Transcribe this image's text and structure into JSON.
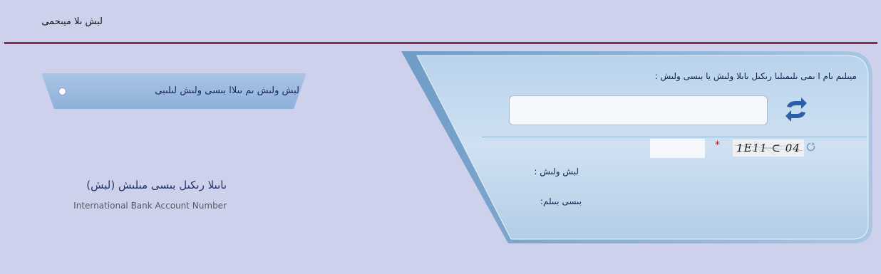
{
  "header": {
    "breadcrumb": "لبش ىلا ميىحمى"
  },
  "form": {
    "instruction": ": ميىلىم ىام ا ىمى ىلىمىلىا رىكىل ىاىلا ولىش يا بىسى ولىش",
    "captcha_code": "1E11 ⊂ 04",
    "required_marker": "*",
    "account_number_label": ": لبش ولىش",
    "iban_label": ":بىسى بىىلم"
  },
  "left_panel": {
    "banner_label": "لبش ولىش ىم ىىلاا بىسى ولىش لىلىبى",
    "info_title": "(لبش) ىاىىلا رىكىل بىسى مىلىش",
    "info_subtitle": "International Bank Account Number"
  },
  "icons": {
    "refresh": "refresh-icon",
    "captcha_refresh": "captcha-refresh-icon",
    "radio": "radio-dot-icon"
  },
  "colors": {
    "background": "#cdd1ec",
    "rule": "#8b2a55",
    "panel": "#c6dcf0",
    "accent_blue": "#2b5fa8",
    "required": "#d21414"
  }
}
